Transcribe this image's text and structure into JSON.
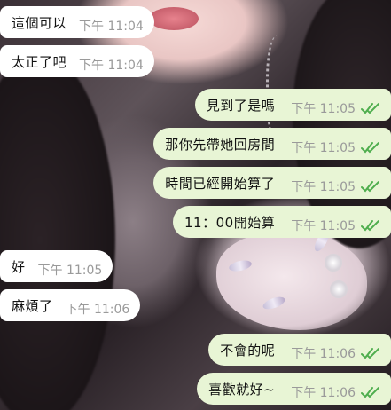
{
  "colors": {
    "incoming_bubble": "#ffffff",
    "outgoing_bubble": "#e8f5d5",
    "read_check": "#4fae4e",
    "time_text": "#9a9a9a"
  },
  "background": {
    "kind": "wallpaper photo"
  },
  "messages": [
    {
      "side": "in",
      "text": "這個可以",
      "time": "下午 11:04"
    },
    {
      "side": "in",
      "text": "太正了吧",
      "time": "下午 11:04"
    },
    {
      "side": "out",
      "text": "見到了是嗎",
      "time": "下午 11:05",
      "status_icon": "double-check-icon"
    },
    {
      "side": "out",
      "text": "那你先帶她回房間",
      "time": "下午 11:05",
      "status_icon": "double-check-icon"
    },
    {
      "side": "out",
      "text": "時間已經開始算了",
      "time": "下午 11:05",
      "status_icon": "double-check-icon"
    },
    {
      "side": "out",
      "text": "11：00開始算",
      "time": "下午 11:05",
      "status_icon": "double-check-icon"
    },
    {
      "side": "in",
      "text": "好",
      "time": "下午 11:05"
    },
    {
      "side": "in",
      "text": "麻煩了",
      "time": "下午 11:06"
    },
    {
      "side": "out",
      "text": "不會的呢",
      "time": "下午 11:06",
      "status_icon": "double-check-icon"
    },
    {
      "side": "out",
      "text": "喜歡就好~",
      "time": "下午 11:06",
      "status_icon": "double-check-icon"
    }
  ]
}
